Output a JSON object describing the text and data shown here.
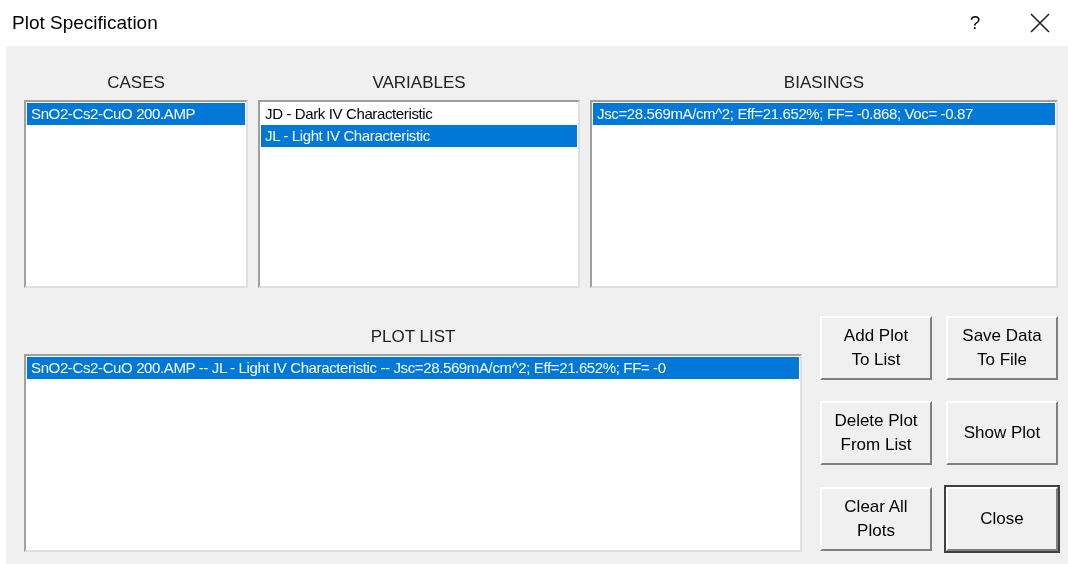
{
  "window": {
    "title": "Plot Specification",
    "help": "?"
  },
  "lists": [
    {
      "title": "CASES",
      "items": [
        {
          "label": "SnO2-Cs2-CuO 200.AMP",
          "selected": true
        }
      ]
    },
    {
      "title": "VARIABLES",
      "items": [
        {
          "label": "JD - Dark IV Characteristic",
          "selected": false
        },
        {
          "label": "JL - Light IV Characteristic",
          "selected": true
        }
      ]
    },
    {
      "title": "BIASINGS",
      "items": [
        {
          "label": "Jsc=28.569mA/cm^2; Eff=21.652%; FF= -0.868; Voc= -0.87",
          "selected": true
        }
      ]
    }
  ],
  "plot_list": {
    "title": "PLOT LIST",
    "items": [
      {
        "label": "SnO2-Cs2-CuO 200.AMP -- JL - Light IV Characteristic -- Jsc=28.569mA/cm^2; Eff=21.652%; FF= -0",
        "selected": true
      }
    ]
  },
  "buttons": [
    {
      "label": "Add Plot\nTo List",
      "default": false
    },
    {
      "label": "Save Data\nTo File",
      "default": false
    },
    {
      "label": "Delete Plot\nFrom List",
      "default": false
    },
    {
      "label": "Show Plot",
      "default": false
    },
    {
      "label": "Clear All\nPlots",
      "default": false
    },
    {
      "label": "Close",
      "default": true
    }
  ]
}
